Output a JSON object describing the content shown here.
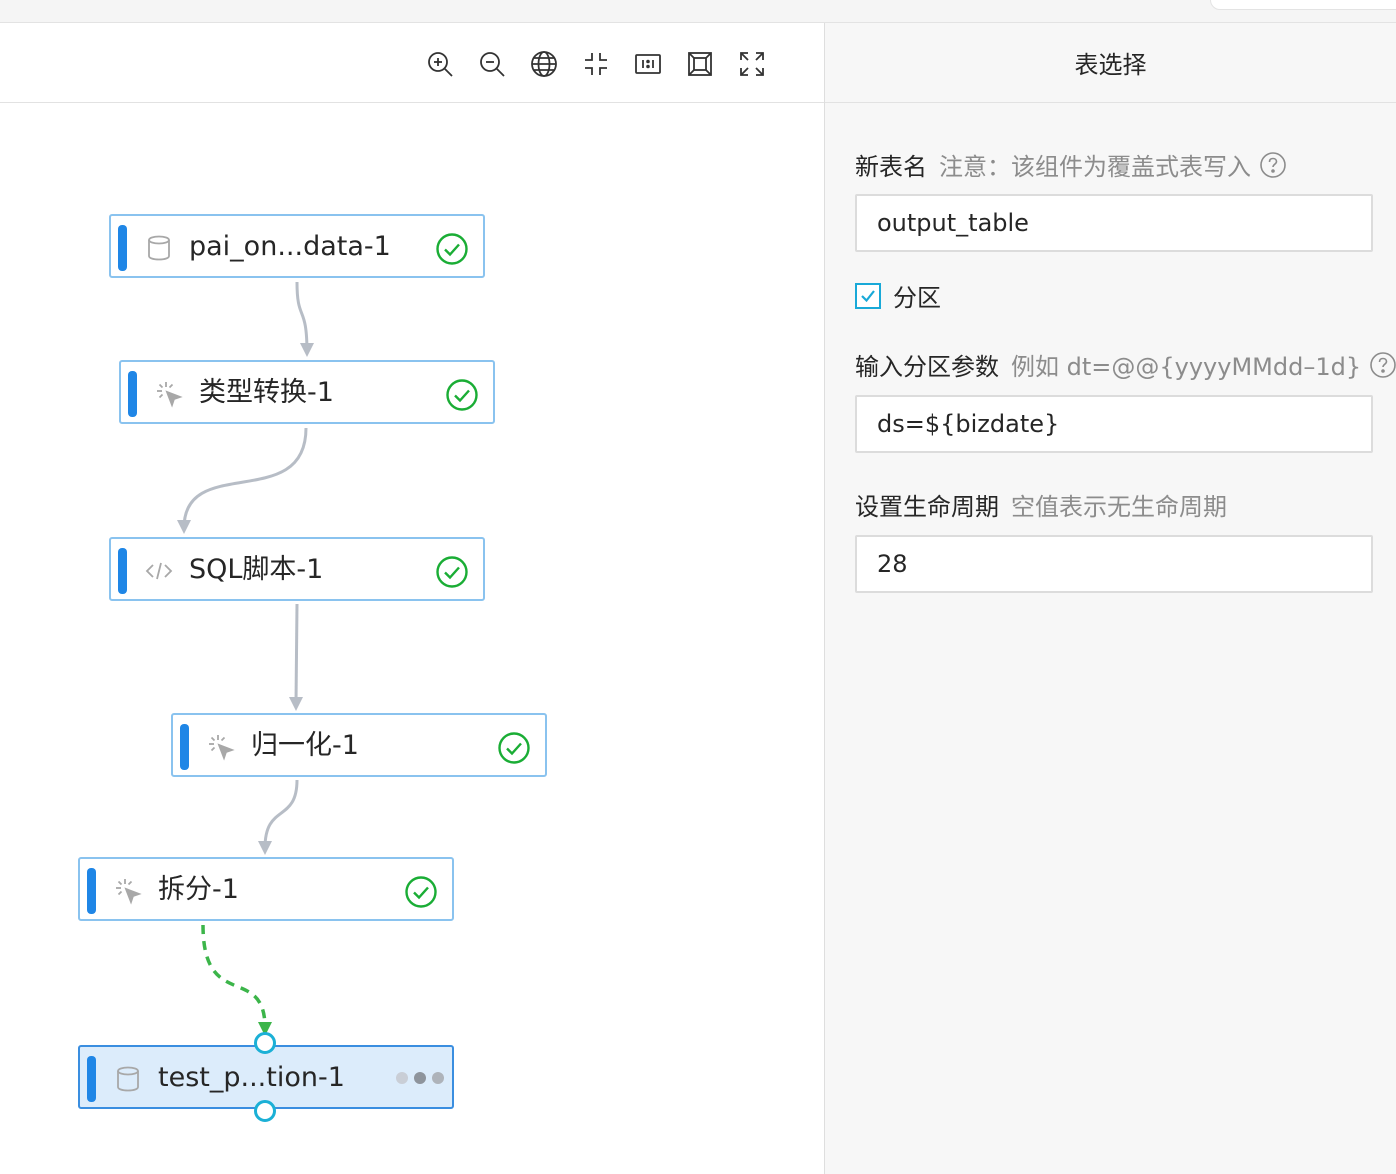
{
  "toolbar": {
    "tools": [
      {
        "icon": "zoom-in-icon"
      },
      {
        "icon": "zoom-out-icon"
      },
      {
        "icon": "globe-icon"
      },
      {
        "icon": "fit-center-icon"
      },
      {
        "icon": "actual-size-icon"
      },
      {
        "icon": "fit-canvas-icon"
      },
      {
        "icon": "fullscreen-icon"
      }
    ]
  },
  "nodes": [
    {
      "label": "pai_on...data-1",
      "icon": "database-icon",
      "status": "success"
    },
    {
      "label": "类型转换-1",
      "icon": "sparkle-cursor-icon",
      "status": "success"
    },
    {
      "label": "SQL脚本-1",
      "icon": "code-icon",
      "status": "success"
    },
    {
      "label": "归一化-1",
      "icon": "sparkle-cursor-icon",
      "status": "success"
    },
    {
      "label": "拆分-1",
      "icon": "sparkle-cursor-icon",
      "status": "success"
    },
    {
      "label": "test_p...tion-1",
      "icon": "database-icon",
      "status": "running"
    }
  ],
  "colors": {
    "accent": "#1f86e6",
    "node_border": "#8ac3ef",
    "success": "#1aad35",
    "edge": "#b7bdc6",
    "edge_active": "#3cb54a",
    "port": "#1bb0d6"
  },
  "panel": {
    "title": "表选择",
    "new_table_label": "新表名",
    "new_table_hint": "注意：该组件为覆盖式表写入",
    "new_table_value": "output_table",
    "partition_checkbox_label": "分区",
    "partition_checked": true,
    "partition_param_label": "输入分区参数",
    "partition_param_hint": "例如 dt=@@{yyyyMMdd–1d}",
    "partition_param_value": "ds=${bizdate}",
    "lifecycle_label": "设置生命周期",
    "lifecycle_hint": "空值表示无生命周期",
    "lifecycle_value": "28"
  }
}
